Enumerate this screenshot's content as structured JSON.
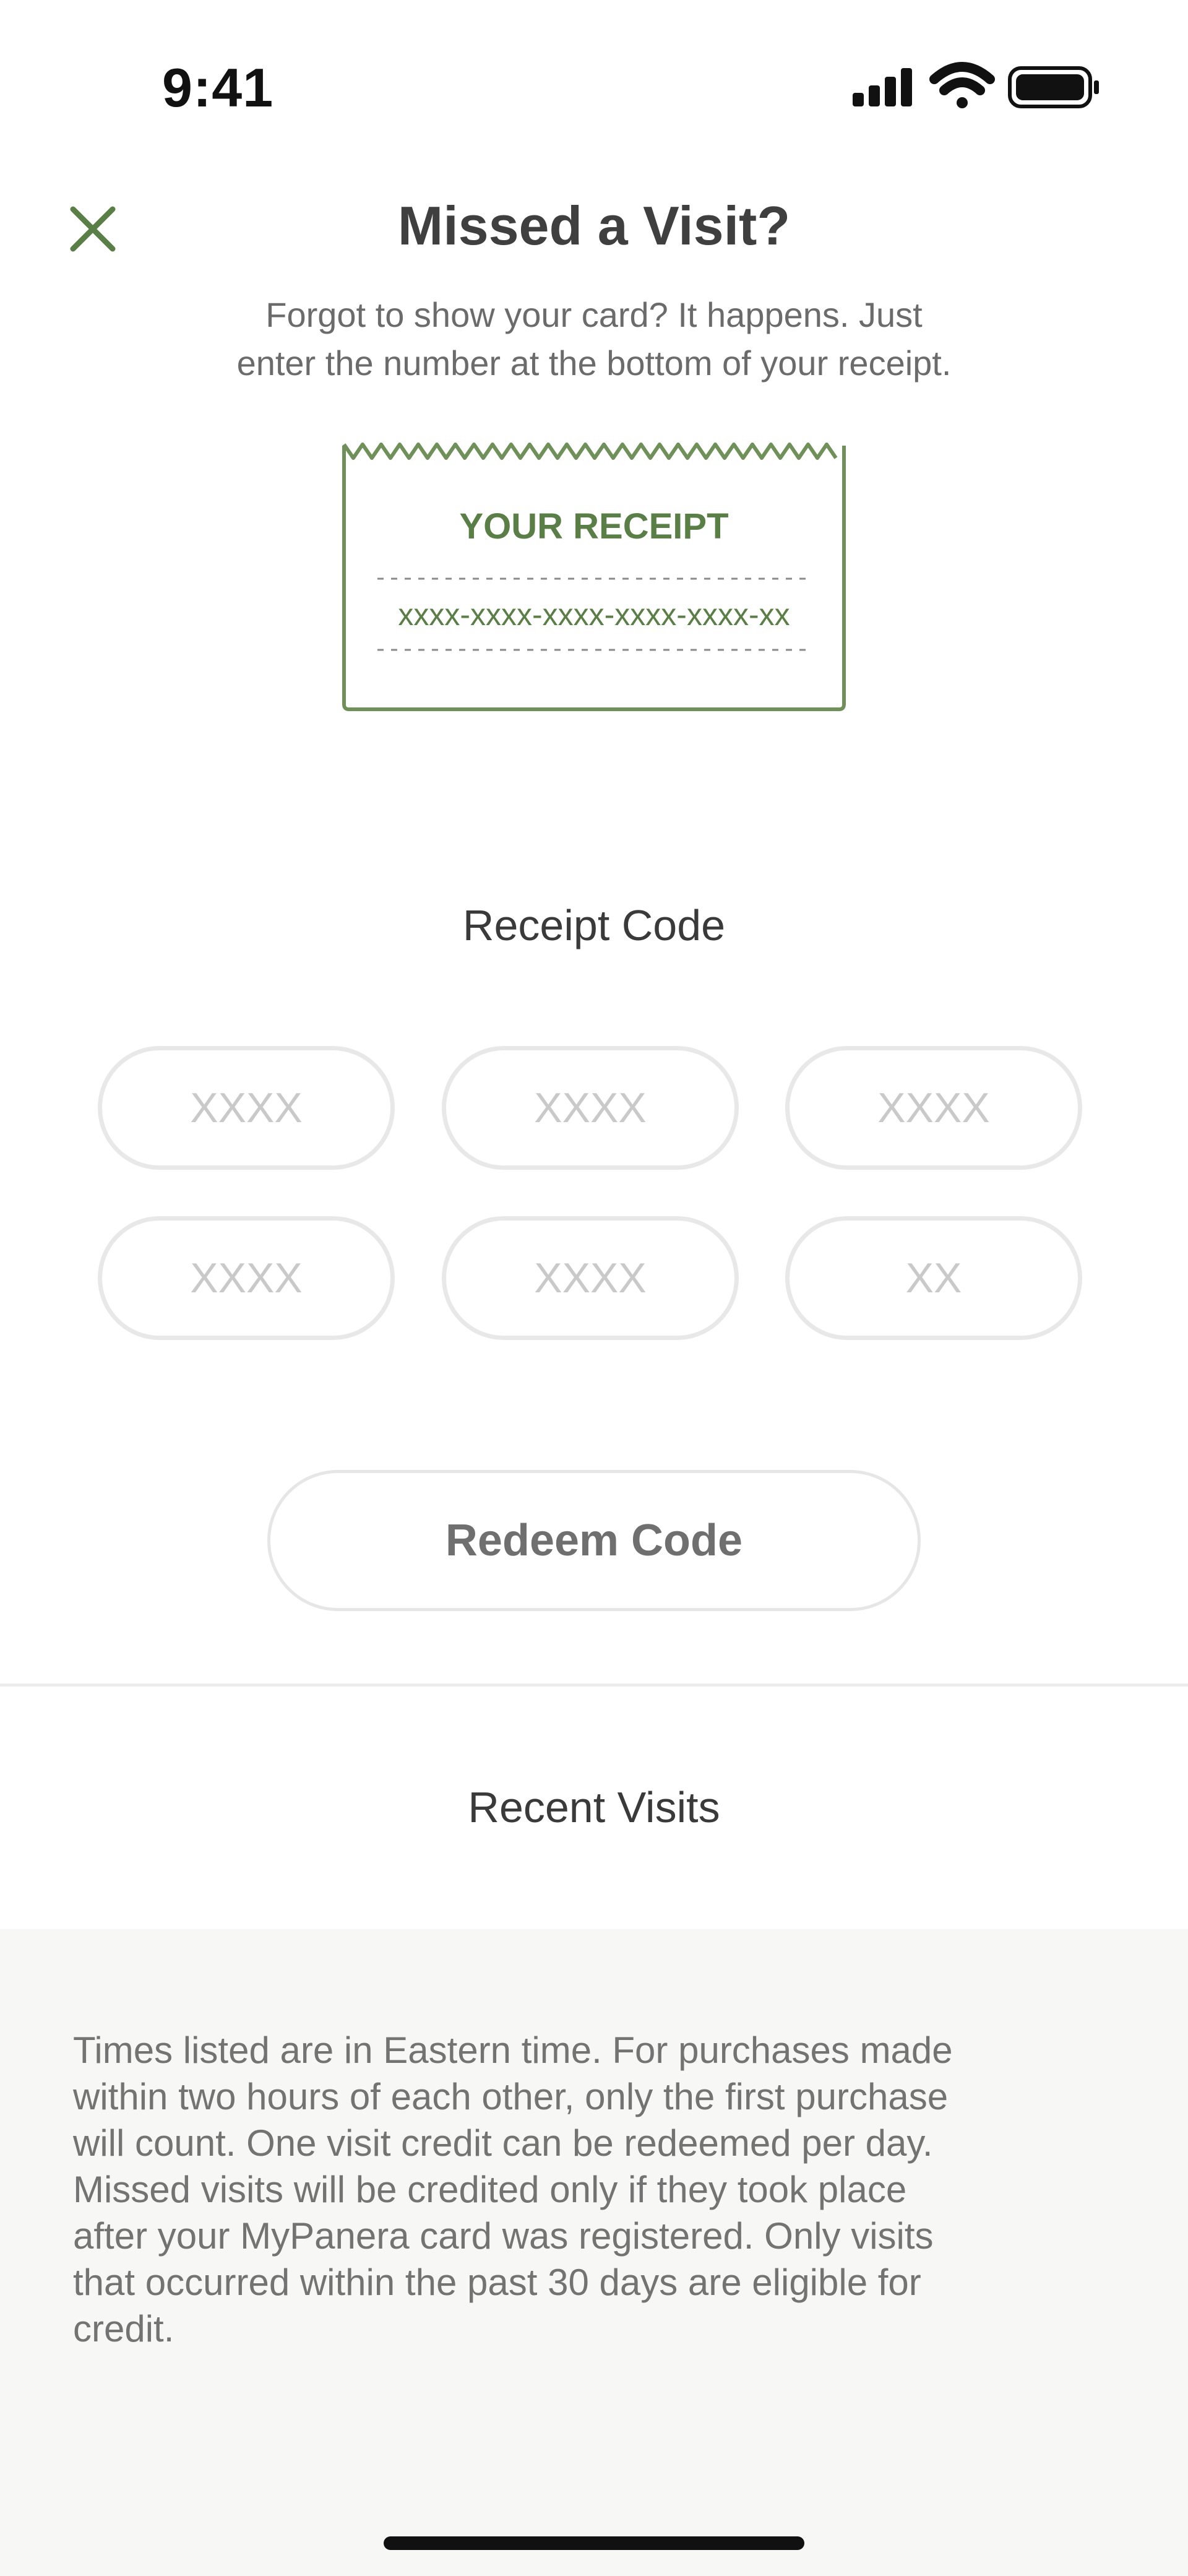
{
  "status_bar": {
    "time": "9:41",
    "icons": [
      "cellular-signal-icon",
      "wifi-icon",
      "battery-icon"
    ]
  },
  "header": {
    "close_icon": "close-icon",
    "title": "Missed a Visit?",
    "subtitle_line1": "Forgot to show your card? It happens. Just",
    "subtitle_line2": "enter the number at the bottom of your receipt."
  },
  "receipt_illustration": {
    "heading": "YOUR RECEIPT",
    "code_sample": "xxxx-xxxx-xxxx-xxxx-xxxx-xx",
    "accent_color": "#5a7f46"
  },
  "receipt_code": {
    "label": "Receipt Code",
    "fields": [
      {
        "value": "",
        "placeholder": "XXXX"
      },
      {
        "value": "",
        "placeholder": "XXXX"
      },
      {
        "value": "",
        "placeholder": "XXXX"
      },
      {
        "value": "",
        "placeholder": "XXXX"
      },
      {
        "value": "",
        "placeholder": "XXXX"
      },
      {
        "value": "",
        "placeholder": "XX"
      }
    ]
  },
  "redeem_button": {
    "label": "Redeem Code"
  },
  "recent_visits": {
    "label": "Recent Visits"
  },
  "footer": {
    "lines": [
      "Times listed are in Eastern time. For purchases made",
      "within two hours of each other, only the first purchase",
      "will count. One visit credit can be redeemed per day.",
      "Missed visits will be credited only if they took place",
      "after your MyPanera card was registered. Only visits",
      "that occurred within the past 30 days are eligible for",
      "credit."
    ]
  },
  "colors": {
    "accent_green": "#5a7f46",
    "title_text": "#3f3f3f",
    "muted_text": "#6b6b6b",
    "input_border": "#e8e8e8",
    "footer_background": "#f7f7f5"
  }
}
